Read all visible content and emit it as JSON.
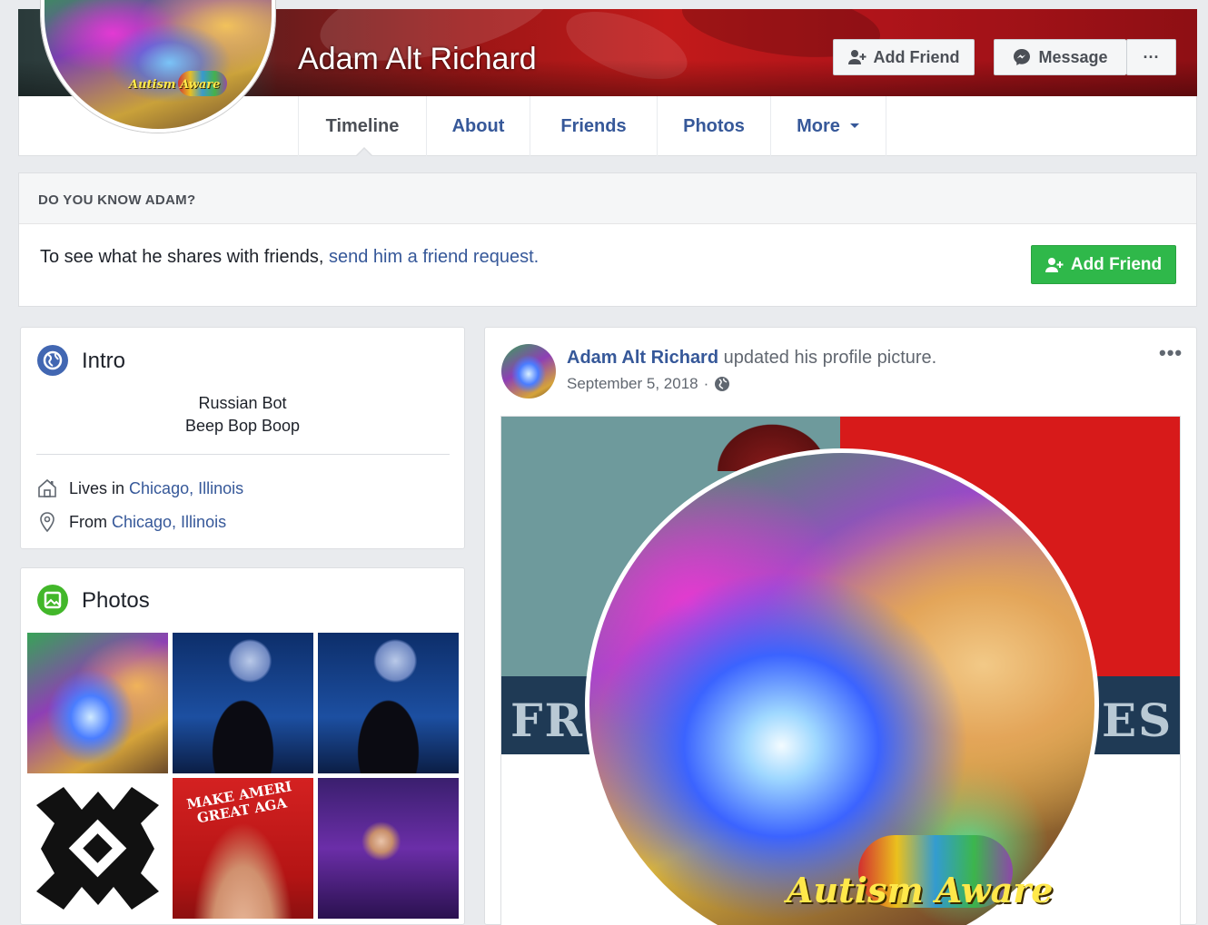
{
  "profile": {
    "name": "Adam Alt Richard",
    "avatar_banner": "Autism Aware"
  },
  "cover_actions": {
    "add_friend_label": "Add Friend",
    "message_label": "Message",
    "more_label": "···"
  },
  "nav": {
    "tabs": [
      {
        "label": "Timeline",
        "active": true
      },
      {
        "label": "About"
      },
      {
        "label": "Friends"
      },
      {
        "label": "Photos"
      },
      {
        "label": "More"
      }
    ]
  },
  "know": {
    "title": "DO YOU KNOW ADAM?",
    "text": "To see what he shares with friends, ",
    "link": "send him a friend request.",
    "add_friend_label": "Add Friend"
  },
  "intro": {
    "title": "Intro",
    "bio_line1": "Russian Bot",
    "bio_line2": "Beep Bop Boop",
    "lives_prefix": "Lives in",
    "lives_city": "Chicago, Illinois",
    "from_prefix": "From",
    "from_city": "Chicago, Illinois"
  },
  "photos": {
    "title": "Photos",
    "thumb5_text": "MAKE AMERI GREAT AGA"
  },
  "post": {
    "author": "Adam Alt Richard",
    "action": " updated his profile picture.",
    "date": "September 5, 2018",
    "separator": "·",
    "options": "•••",
    "image_band_left": "FR",
    "image_band_right": "ES",
    "image_banner": "Autism Aware"
  },
  "icons": {
    "add_friend": "add-friend-icon",
    "messenger": "messenger-icon",
    "globe": "globe-icon",
    "home": "home-icon",
    "location": "location-pin-icon",
    "photos": "photos-icon",
    "caret": "caret-down-icon"
  },
  "colors": {
    "link": "#365899",
    "fb_blue": "#4267b2",
    "green_button": "#2fb84a",
    "background": "#e9ebee"
  }
}
